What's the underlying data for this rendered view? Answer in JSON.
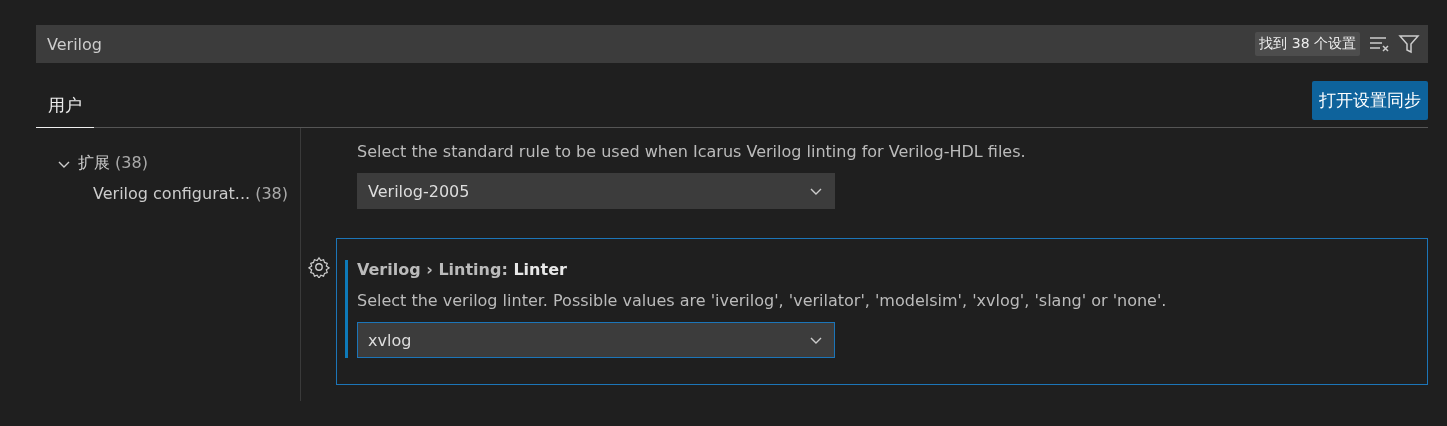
{
  "search": {
    "value": "Verilog",
    "results_badge": "找到 38 个设置"
  },
  "tabs": [
    {
      "label": "用户",
      "selected": true
    }
  ],
  "sync_button": "打开设置同步",
  "tree": [
    {
      "label": "扩展",
      "count": "(38)",
      "expanded": true,
      "children": [
        {
          "label": "Verilog configurat...",
          "count": "(38)"
        }
      ]
    }
  ],
  "settings": [
    {
      "description": "Select the standard rule to be used when Icarus Verilog linting for Verilog-HDL files.",
      "value": "Verilog-2005",
      "focused": false
    },
    {
      "title": "Verilog › Linting: **Linter**",
      "description": "Select the verilog linter. Possible values are 'iverilog', 'verilator', 'modelsim', 'xvlog', 'slang' or 'none'.",
      "value": "xvlog",
      "focused": true
    }
  ]
}
